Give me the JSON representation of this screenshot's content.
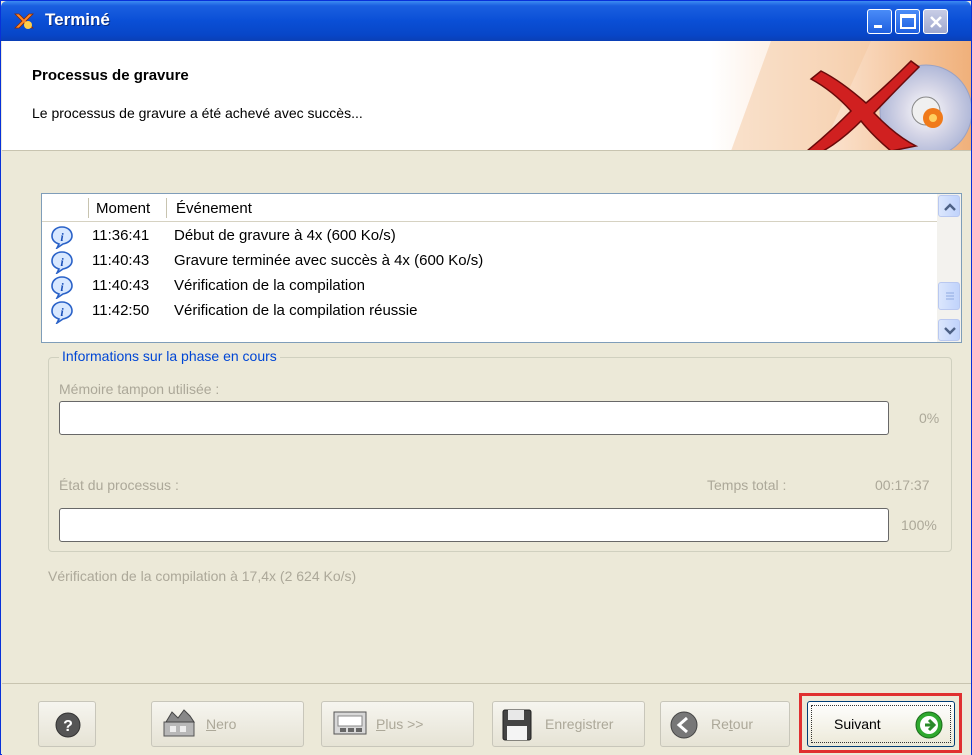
{
  "window": {
    "title": "Terminé",
    "colors": {
      "titlebar": "#0a4fd6",
      "window_bg": "#ece9d8",
      "highlight": "#e03030",
      "legend": "#0046d5"
    }
  },
  "header": {
    "title": "Processus de gravure",
    "subtitle": "Le processus de gravure a été achevé avec succès...",
    "logo_icon": "nero-x-disc-icon"
  },
  "event_list": {
    "columns": {
      "time": "Moment",
      "event": "Événement"
    },
    "rows": [
      {
        "icon": "info-icon",
        "time": "11:36:41",
        "event": "Début de gravure à 4x (600 Ko/s)"
      },
      {
        "icon": "info-icon",
        "time": "11:40:43",
        "event": "Gravure terminée avec succès à 4x (600 Ko/s)"
      },
      {
        "icon": "info-icon",
        "time": "11:40:43",
        "event": "Vérification de la compilation"
      },
      {
        "icon": "info-icon",
        "time": "11:42:50",
        "event": "Vérification de la compilation réussie"
      }
    ]
  },
  "phase": {
    "legend": "Informations sur la phase en cours",
    "buffer_label": "Mémoire tampon utilisée :",
    "buffer_percent": "0%",
    "buffer_fill": 0,
    "process_label": "État du processus :",
    "total_time_label": "Temps total :",
    "total_time": "00:17:37",
    "process_percent": "100%",
    "process_fill": 1.0
  },
  "status_line": "Vérification de la compilation à 17,4x (2 624 Ko/s)",
  "buttons": {
    "help_icon": "help-icon",
    "nero_label": "Nero",
    "plus_label": "Plus >>",
    "save_label": "Enregistrer",
    "back_label": "Retour",
    "next_label": "Suivant"
  }
}
